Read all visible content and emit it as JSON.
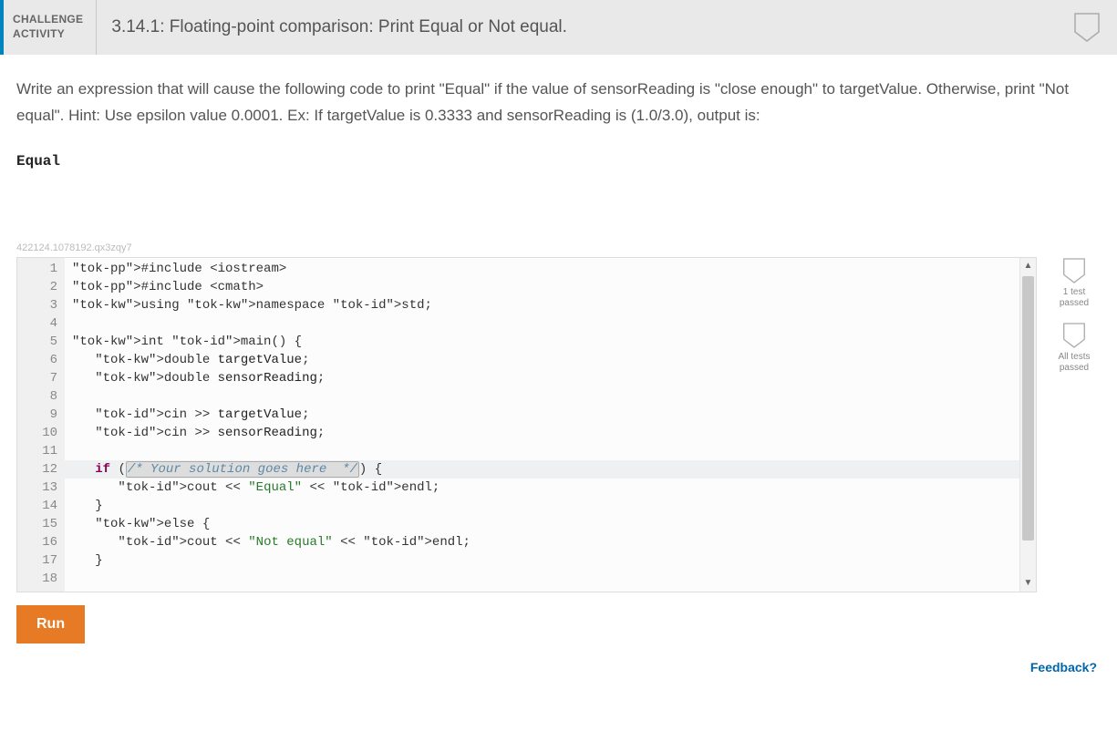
{
  "header": {
    "label_line1": "CHALLENGE",
    "label_line2": "ACTIVITY",
    "title": "3.14.1: Floating-point comparison: Print Equal or Not equal."
  },
  "description": "Write an expression that will cause the following code to print \"Equal\" if the value of sensorReading is \"close enough\" to targetValue. Otherwise, print \"Not equal\". Hint: Use epsilon value 0.0001. Ex: If targetValue is 0.3333 and sensorReading is (1.0/3.0), output is:",
  "example_output": "Equal",
  "hash": "422124.1078192.qx3zqy7",
  "code": {
    "lines": [
      "#include <iostream>",
      "#include <cmath>",
      "using namespace std;",
      "",
      "int main() {",
      "   double targetValue;",
      "   double sensorReading;",
      "",
      "   cin >> targetValue;",
      "   cin >> sensorReading;",
      "",
      "   if (/* Your solution goes here  */) {",
      "      cout << \"Equal\" << endl;",
      "   }",
      "   else {",
      "      cout << \"Not equal\" << endl;",
      "   }",
      ""
    ],
    "highlighted_line": 12
  },
  "badges": {
    "b1": "1 test passed",
    "b2": "All tests passed"
  },
  "run_label": "Run",
  "feedback_label": "Feedback?"
}
